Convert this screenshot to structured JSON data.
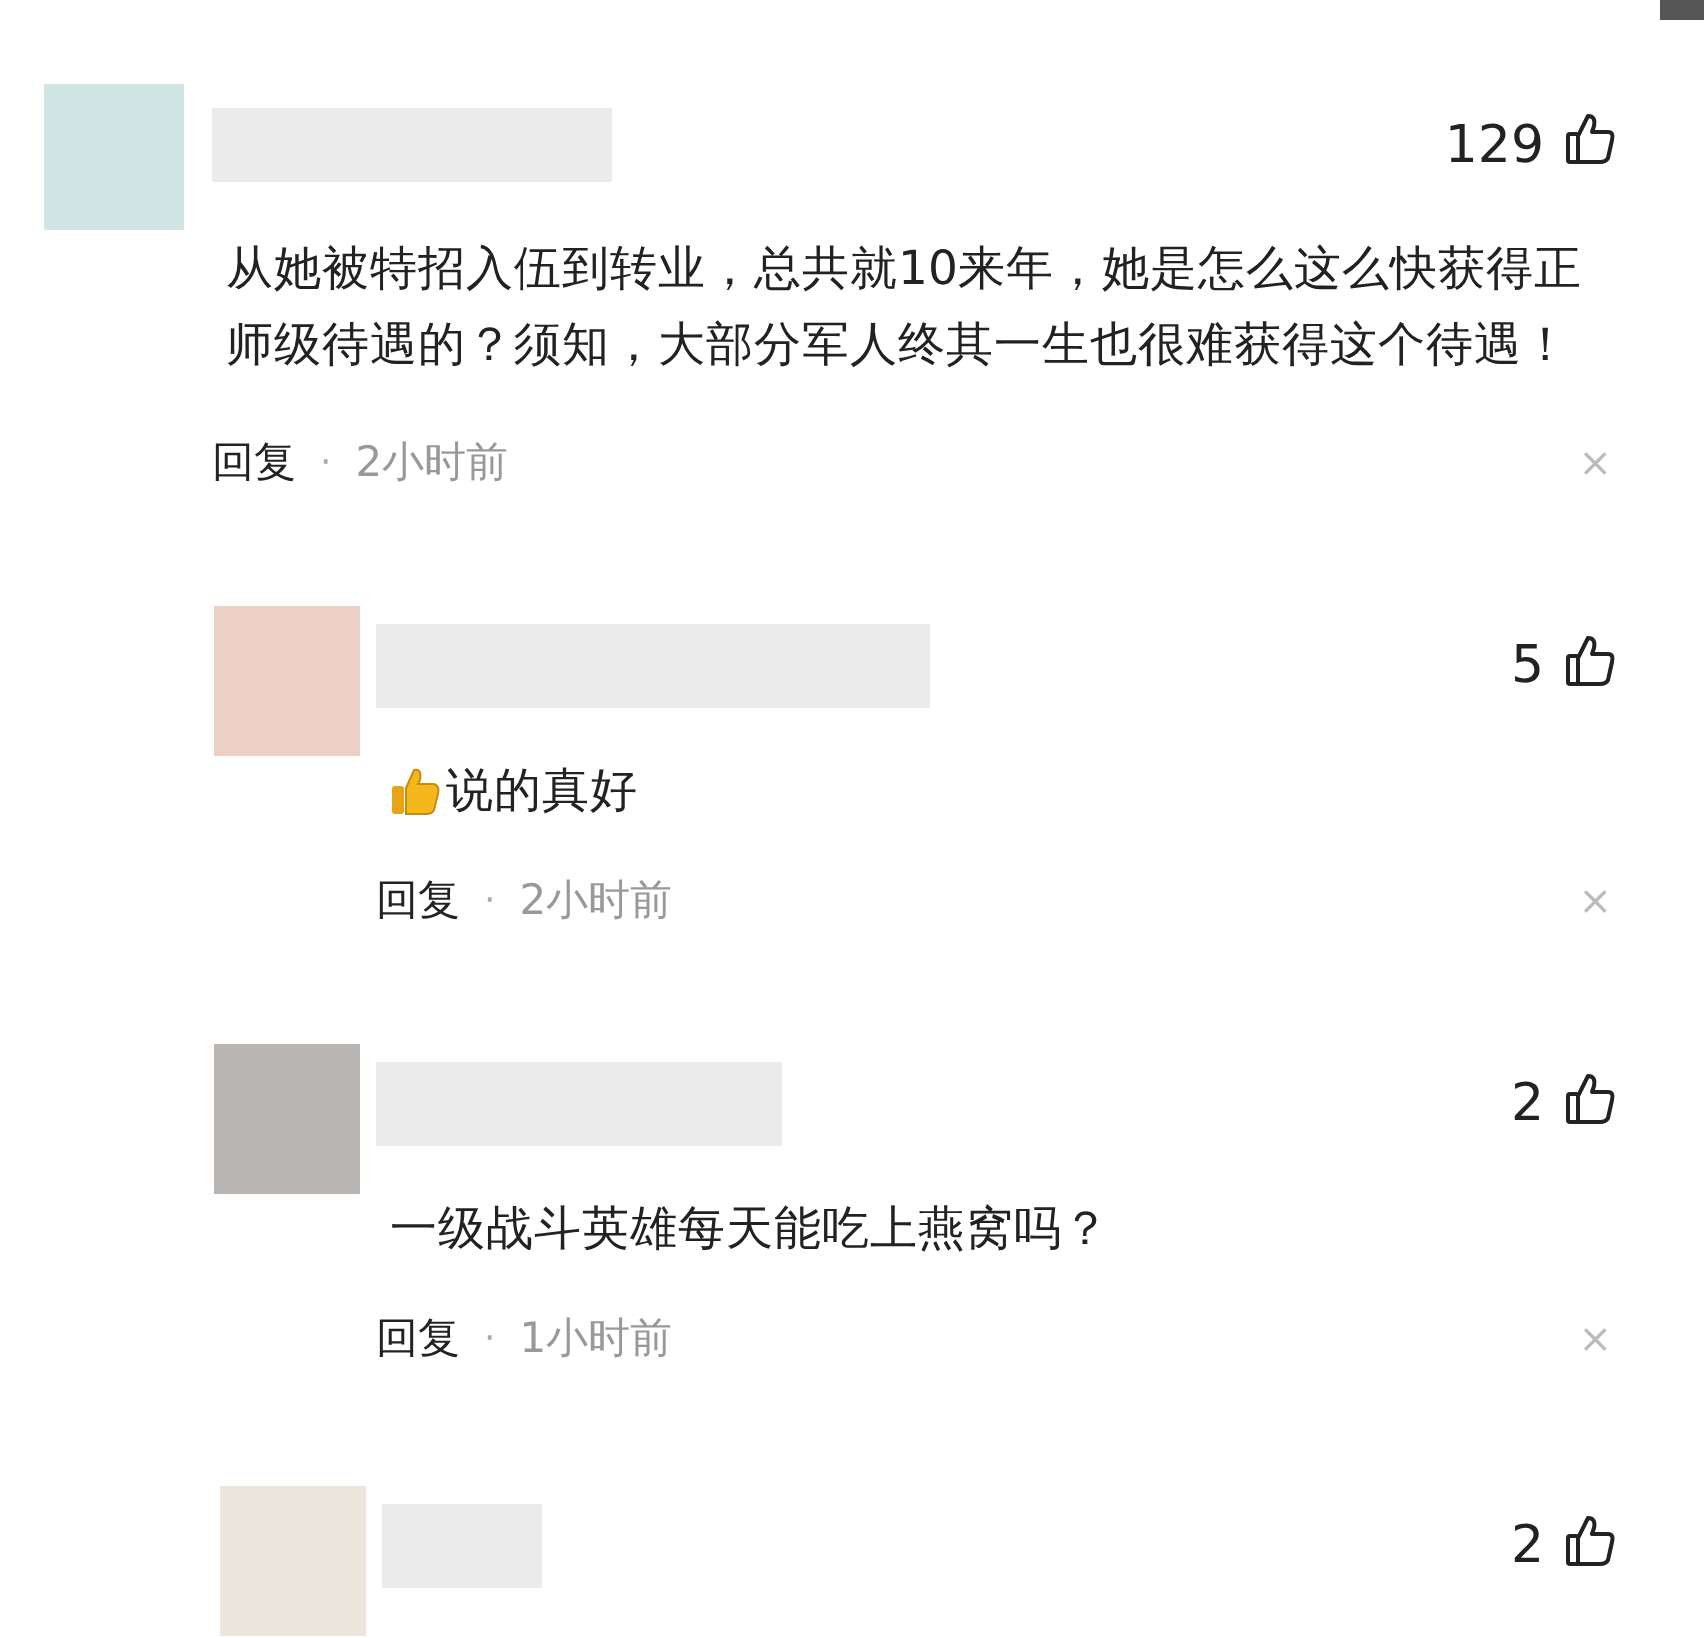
{
  "comments": [
    {
      "avatar": {
        "color": "#cfe6e4"
      },
      "likes": "129",
      "kind": "text",
      "text": "从她被特招入伍到转业，总共就10来年，她是怎么这么快获得正师级待遇的？须知，大部分军人终其一生也很难获得这个待遇！",
      "reply": "回复",
      "dot": "·",
      "time": "2小时前",
      "close": "×"
    },
    {
      "avatar": {
        "color": "#ecd0c5"
      },
      "likes": "5",
      "kind": "emoji-text",
      "text": "说的真好",
      "reply": "回复",
      "dot": "·",
      "time": "2小时前",
      "close": "×"
    },
    {
      "avatar": {
        "color": "#b9b5b2"
      },
      "likes": "2",
      "kind": "text",
      "text": "一级战斗英雄每天能吃上燕窝吗？",
      "reply": "回复",
      "dot": "·",
      "time": "1小时前",
      "close": "×"
    },
    {
      "avatar": {
        "color": "#ede6dc"
      },
      "likes": "2",
      "kind": "cut"
    }
  ]
}
